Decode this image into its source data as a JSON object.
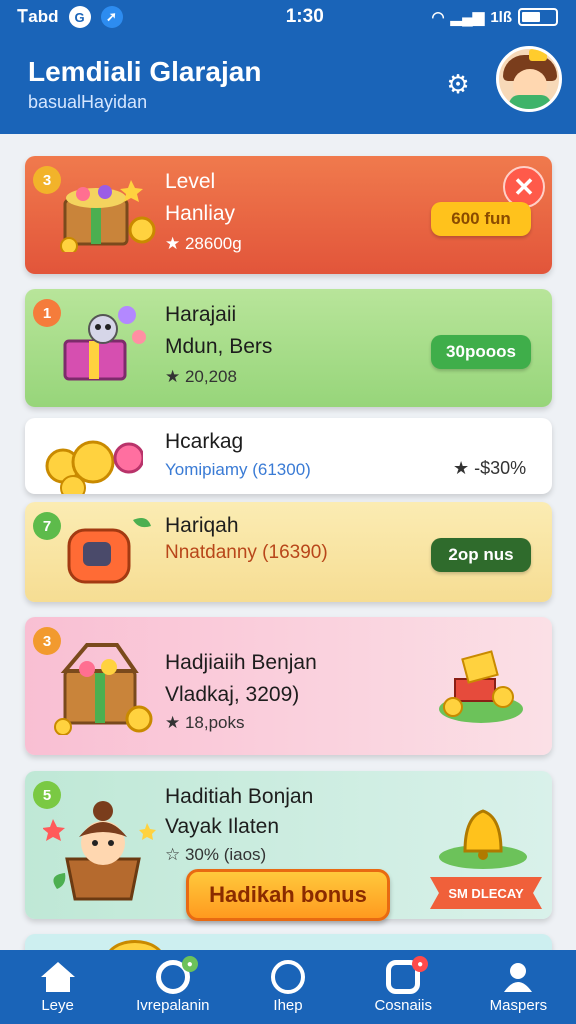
{
  "status_bar": {
    "left_text": "Ꭲabd",
    "time": "1:30",
    "right_text": "1lß"
  },
  "header": {
    "title": "Lemdiali Glarajan",
    "subtitle": "basualHayidan"
  },
  "colors": {
    "brand": "#1a64b8",
    "card_red": "#e2553a",
    "card_green": "#97d57a",
    "card_yellow": "#f6dd93",
    "card_pink": "#f9bfd3",
    "card_mint": "#bfe8d6"
  },
  "cards": [
    {
      "badge": "3",
      "line1": "Level",
      "line2": "Hanliay",
      "line3": "★ 28600g",
      "pill": "600 fun"
    },
    {
      "badge": "1",
      "line1": "Harajaii",
      "line2": "Mdun, Bers",
      "line3": "★ 20,208",
      "pill": "30pooos"
    },
    {
      "line1": "Hcarkag",
      "line2": "Yomipiamy (61300)",
      "value": "★ -$30%"
    },
    {
      "badge": "7",
      "line1": "Hariqah",
      "line2": "Nnatdanny (16390)",
      "pill": "2op nus"
    },
    {
      "badge": "3",
      "line1": "Hadjiaiih Benjan",
      "line2": "Vladkaj, 3209)",
      "line3": "★ 18,poks"
    },
    {
      "badge": "5",
      "line1": "Haditiah Bonjan",
      "line2": "Vayak Ilaten",
      "line3": "☆ 30% (iaos)",
      "button": "Hadikah bonus",
      "ribbon": "SM DLECAY"
    }
  ],
  "nav": [
    {
      "label": "Leye",
      "icon": "home-icon"
    },
    {
      "label": "Ivrepalanin",
      "icon": "target-icon"
    },
    {
      "label": "Ihep",
      "icon": "shield-icon"
    },
    {
      "label": "Cosnaiis",
      "icon": "chat-icon"
    },
    {
      "label": "Maspers",
      "icon": "user-icon"
    }
  ]
}
